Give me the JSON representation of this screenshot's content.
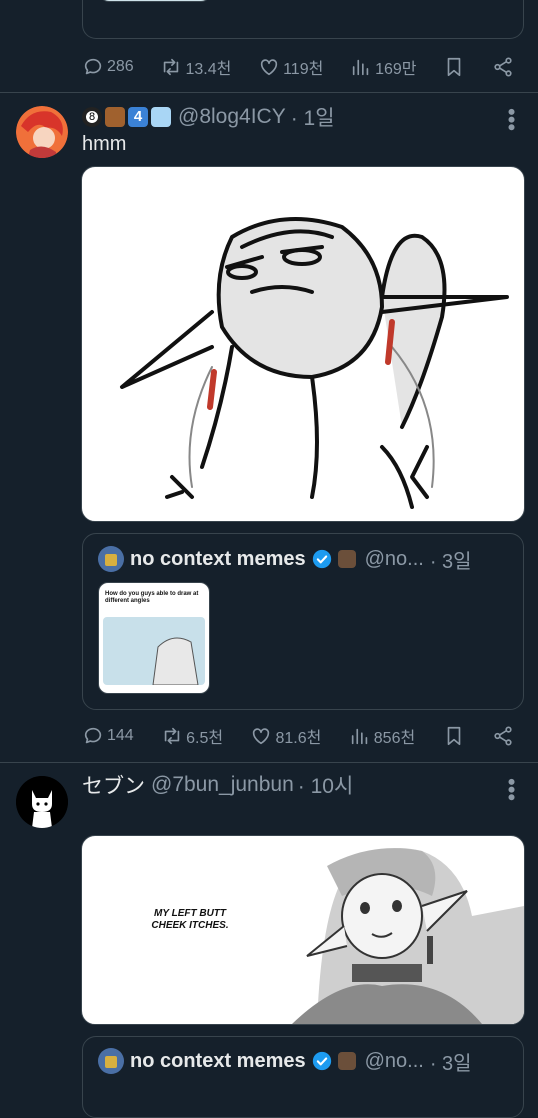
{
  "tweet0": {
    "actions": {
      "replies": "286",
      "retweets": "13.4천",
      "likes": "119천",
      "views": "169만"
    }
  },
  "tweet1": {
    "handle": "@8log4ICY",
    "time": "· 1일",
    "text": "hmm",
    "badge_number": "4",
    "ball_number": "8",
    "quote": {
      "name": "no context memes",
      "handle": "@no...",
      "time": "· 3일",
      "thumb_text": "How do you guys able to draw at different angles"
    },
    "actions": {
      "replies": "144",
      "retweets": "6.5천",
      "likes": "81.6천",
      "views": "856천"
    }
  },
  "tweet2": {
    "name": "セブン",
    "handle": "@7bun_junbun",
    "time": "· 10시",
    "image_text": "MY LEFT BUTT CHEEK ITCHES.",
    "quote": {
      "name": "no context memes",
      "handle": "@no...",
      "time": "· 3일"
    }
  },
  "icons": [
    "reply-icon",
    "retweet-icon",
    "like-icon",
    "views-icon",
    "bookmark-icon",
    "share-icon",
    "more-icon",
    "verified-icon"
  ],
  "colors": {
    "background": "#15202b",
    "muted": "#8b98a5",
    "verified": "#1d9bf0",
    "border": "#38444d"
  }
}
